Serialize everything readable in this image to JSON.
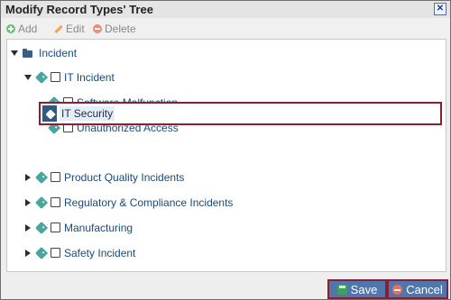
{
  "dialog": {
    "title": "Modify Record Types' Tree",
    "close_label": "✕"
  },
  "toolbar": {
    "add_label": "Add",
    "edit_label": "Edit",
    "delete_label": "Delete"
  },
  "tree": {
    "root": "Incident",
    "it_incident": "IT Incident",
    "software_malfunction": "Software Malfunction",
    "unauthorized_access": "Unauthorized Access",
    "it_security": "IT Security",
    "product_quality": "Product Quality Incidents",
    "regulatory": "Regulatory & Compliance Incidents",
    "manufacturing": "Manufacturing",
    "safety": "Safety Incident"
  },
  "footer": {
    "save_label": "Save",
    "cancel_label": "Cancel"
  },
  "colors": {
    "accent": "#8b1f2f",
    "button_blue": "#5077ac",
    "tag_teal": "#4aa69d",
    "folder_blue": "#3a5f85"
  }
}
